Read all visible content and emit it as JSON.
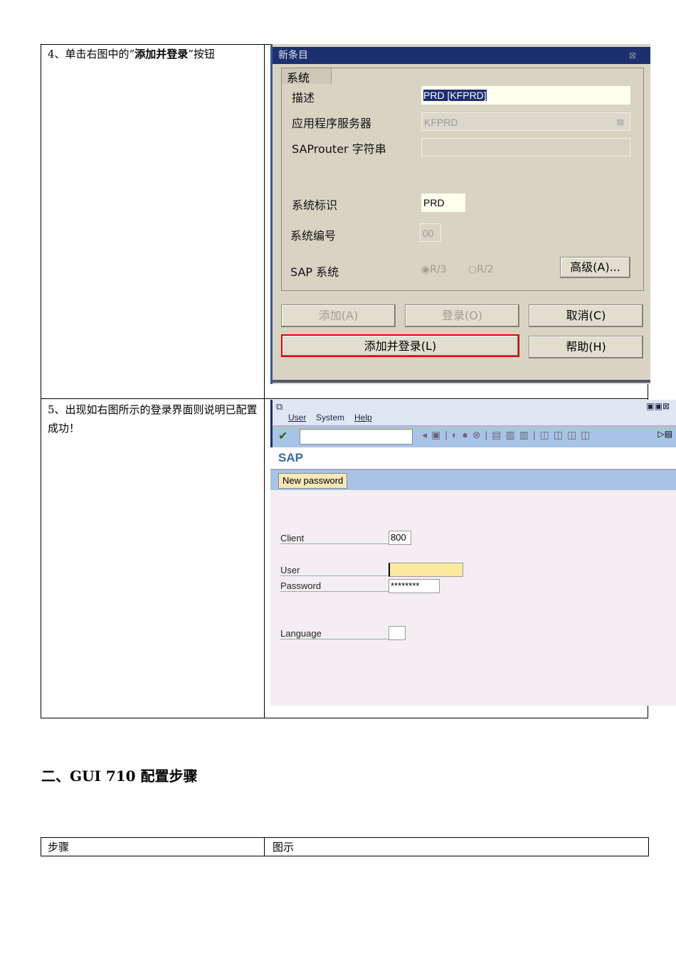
{
  "row4": {
    "prefix": "4、单击右图中的“",
    "bold": "添加并登录",
    "suffix": "”按钮"
  },
  "row5": {
    "text": "5、出现如右图所示的登录界面则说明已配置成功！"
  },
  "dialog": {
    "title": "新条目",
    "tab": "系统",
    "fields": {
      "desc_label": "描述",
      "desc_value": "PRD [KFPRD]",
      "server_label": "应用程序服务器",
      "server_value": "KFPRD",
      "router_label": "SAProuter 字符串",
      "router_value": "",
      "sysid_label": "系统标识",
      "sysid_value": "PRD",
      "sysno_label": "系统编号",
      "sysno_value": "00",
      "saptype_label": "SAP 系统",
      "r3": "R/3",
      "r2": "R/2"
    },
    "buttons": {
      "advanced": "高级(A)...",
      "add": "添加(A)",
      "logon": "登录(O)",
      "cancel": "取消(C)",
      "add_logon": "添加并登录(L)",
      "help": "帮助(H)"
    }
  },
  "sap": {
    "menu": [
      "User",
      "System",
      "Help"
    ],
    "title": "SAP",
    "new_password": "New password",
    "client_label": "Client",
    "client_value": "800",
    "user_label": "User",
    "user_value": "",
    "password_label": "Password",
    "password_value": "********",
    "language_label": "Language",
    "language_value": ""
  },
  "section": {
    "heading": "二、GUI 710 配置步骤"
  },
  "table2": {
    "headers": [
      "步骤",
      "图示"
    ]
  },
  "colors": {
    "highlight": "#e00000",
    "title_bar": "#1c2f6e",
    "sap_blue": "#a9c3e6"
  }
}
